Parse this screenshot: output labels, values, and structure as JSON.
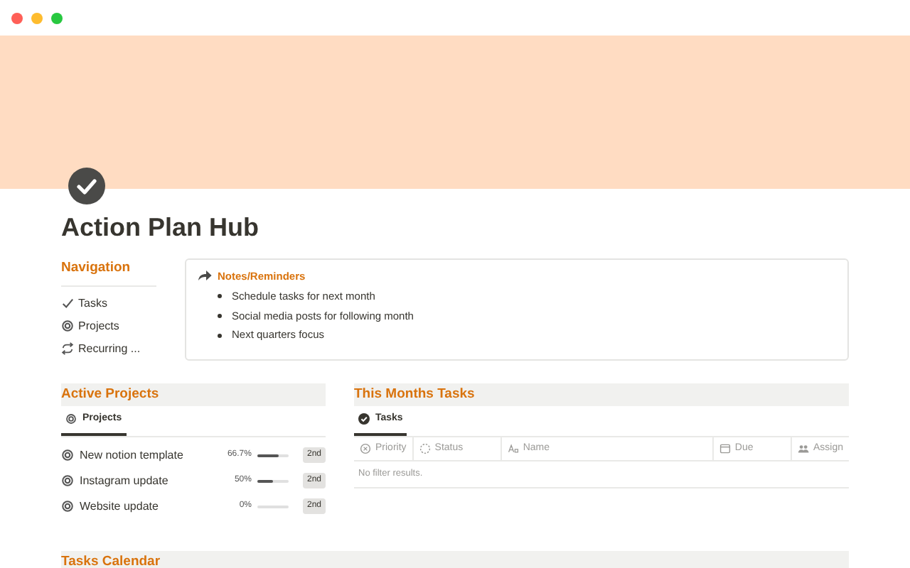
{
  "window": {
    "controls": [
      {
        "color": "#ff5f57"
      },
      {
        "color": "#febc2e"
      },
      {
        "color": "#28c840"
      }
    ]
  },
  "page": {
    "title": "Action Plan Hub"
  },
  "navigation": {
    "heading": "Navigation",
    "items": [
      {
        "label": "Tasks",
        "kind": "check"
      },
      {
        "label": "Projects",
        "kind": "target"
      },
      {
        "label": "Recurring ...",
        "kind": "repeat"
      }
    ]
  },
  "callout": {
    "title": "Notes/Reminders",
    "items": [
      "Schedule tasks for next month",
      "Social media posts for following month",
      "Next quarters focus"
    ]
  },
  "active_projects": {
    "heading": "Active Projects",
    "tab": {
      "label": "Projects",
      "selected": true
    },
    "rows": [
      {
        "name": "New notion template",
        "percent": "66.7%",
        "level": 0.667,
        "tag": "2nd"
      },
      {
        "name": "Instagram update",
        "percent": "50%",
        "level": 0.5,
        "tag": "2nd"
      },
      {
        "name": "Website update",
        "percent": "0%",
        "level": 0,
        "tag": "2nd"
      }
    ]
  },
  "month_tasks": {
    "heading": "This Months Tasks",
    "tab": {
      "label": "Tasks",
      "selected": true
    },
    "columns": [
      {
        "label": "Priority",
        "kind": "select"
      },
      {
        "label": "Status",
        "kind": "status"
      },
      {
        "label": "Name",
        "kind": "title"
      },
      {
        "label": "Due",
        "kind": "date"
      },
      {
        "label": "Assign",
        "kind": "person"
      }
    ],
    "empty": "No filter results."
  },
  "calendar": {
    "heading": "Tasks Calendar"
  }
}
